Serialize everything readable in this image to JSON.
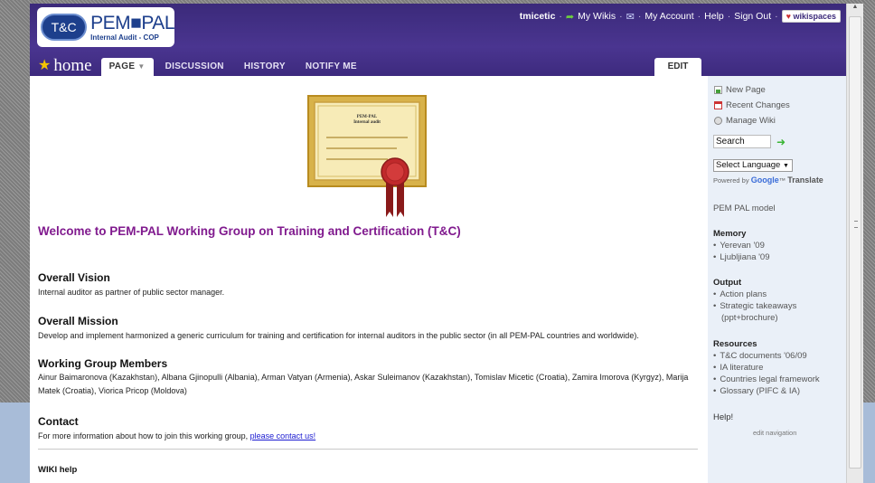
{
  "logo": {
    "badge": "T&C",
    "main": "PEM■PAL",
    "sub": "Internal Audit - COP"
  },
  "usernav": {
    "username": "tmicetic",
    "my_wikis": "My Wikis",
    "my_account": "My Account",
    "help": "Help",
    "sign_out": "Sign Out",
    "brand": "wikispaces",
    "separator": "·"
  },
  "page": {
    "title": "home"
  },
  "tabs": [
    {
      "label": "PAGE"
    },
    {
      "label": "DISCUSSION"
    },
    {
      "label": "HISTORY"
    },
    {
      "label": "NOTIFY ME"
    }
  ],
  "edit_label": "EDIT",
  "certificate": {
    "line1": "PEM-PAL",
    "line2": "Internal audit"
  },
  "content": {
    "welcome": "Welcome to PEM-PAL Working Group on Training and Certification (T&C)",
    "vision_h": "Overall Vision",
    "vision_p": "Internal auditor as partner of public sector manager.",
    "mission_h": "Overall Mission",
    "mission_p": "Develop and implement harmonized a generic curriculum for training and certification for internal auditors in the public sector (in all PEM-PAL countries and worldwide).",
    "members_h": "Working Group Members",
    "members_p": "Ainur Baimaronova (Kazakhstan), Albana Gjinopulli (Albania), Arman Vatyan (Armenia), Askar Suleimanov (Kazakhstan), Tomislav Micetic (Croatia), Zamira Imorova (Kyrgyz), Marija Matek (Croatia), Viorica Pricop (Moldova)",
    "contact_h": "Contact",
    "contact_p": "For more information about how to join this working group,",
    "contact_link": "please contact us!",
    "wikihelp_h": "WIKI help"
  },
  "sidebar": {
    "new_page": "New Page",
    "recent_changes": "Recent Changes",
    "manage_wiki": "Manage Wiki",
    "search_value": "Search",
    "language": "Select Language",
    "powered_by": "Powered by",
    "google": "Google",
    "translate": "Translate",
    "model": "PEM PAL model",
    "memory_h": "Memory",
    "memory": [
      "Yerevan '09",
      "Ljubljiana '09"
    ],
    "output_h": "Output",
    "output": [
      "Action plans",
      "Strategic takeaways",
      "(ppt+brochure)"
    ],
    "resources_h": "Resources",
    "resources": [
      "T&C documents '06/09",
      "IA literature",
      "Countries legal framework",
      "Glossary (PIFC & IA)"
    ],
    "help": "Help!",
    "edit_navigation": "edit navigation"
  }
}
